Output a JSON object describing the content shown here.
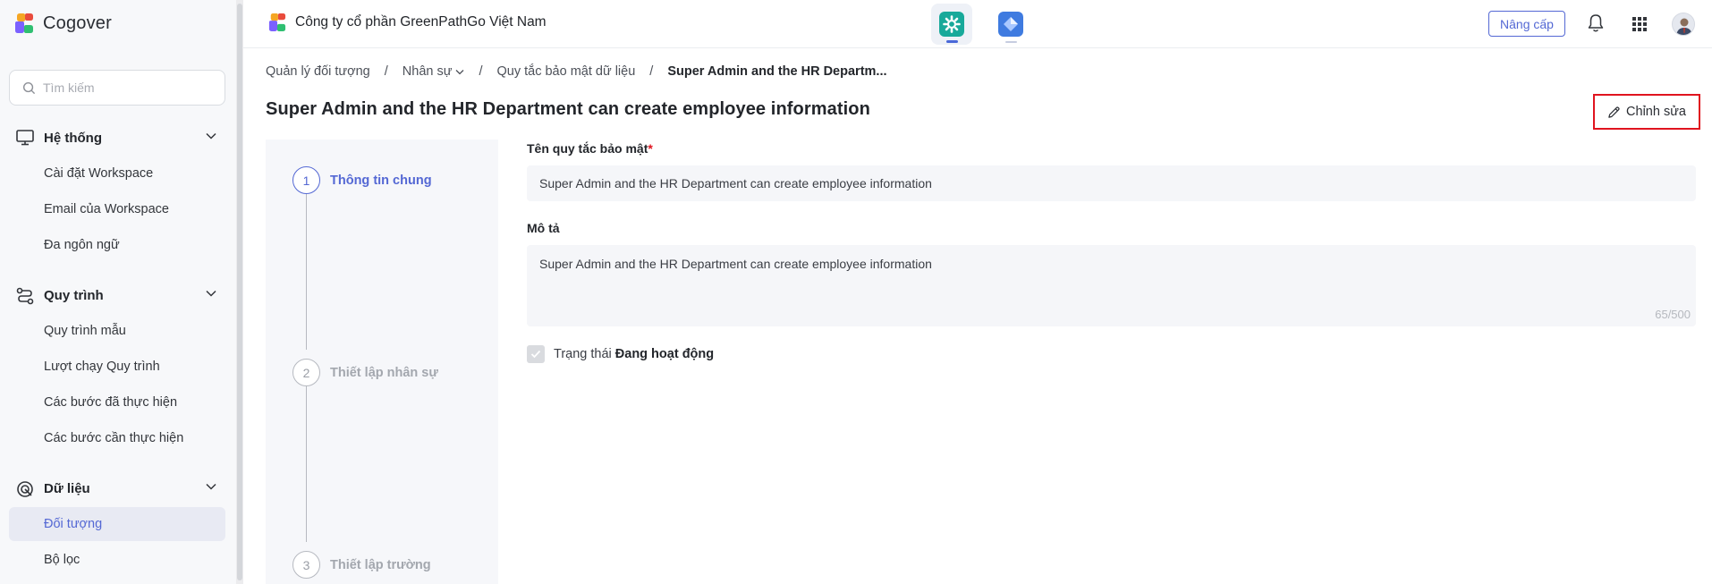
{
  "app": {
    "name": "Cogover",
    "brand_colors": [
      "#f5a623",
      "#e94b3c",
      "#7b61ff",
      "#2fbf71"
    ]
  },
  "sidebar": {
    "search_placeholder": "Tìm kiếm",
    "groups": [
      {
        "label": "Hệ thống",
        "icon": "monitor-icon",
        "items": [
          {
            "label": "Cài đặt Workspace"
          },
          {
            "label": "Email của Workspace"
          },
          {
            "label": "Đa ngôn ngữ"
          }
        ]
      },
      {
        "label": "Quy trình",
        "icon": "workflow-icon",
        "items": [
          {
            "label": "Quy trình mẫu"
          },
          {
            "label": "Lượt chạy Quy trình"
          },
          {
            "label": "Các bước đã thực hiện"
          },
          {
            "label": "Các bước cần thực hiện"
          }
        ]
      },
      {
        "label": "Dữ liệu",
        "icon": "data-icon",
        "items": [
          {
            "label": "Đối tượng",
            "active": true
          },
          {
            "label": "Bộ lọc"
          }
        ]
      }
    ]
  },
  "topbar": {
    "company_name": "Công ty cổ phần GreenPathGo Việt Nam",
    "apps": [
      {
        "icon": "settings-app-icon",
        "active": true,
        "color": "#18a99a"
      },
      {
        "icon": "diamond-app-icon",
        "active": false,
        "color": "#3f7be0"
      }
    ],
    "upgrade_label": "Nâng cấp",
    "icons": [
      "bell-icon",
      "apps-grid-icon",
      "avatar"
    ]
  },
  "breadcrumb": {
    "items": [
      "Quản lý đối tượng",
      "Nhân sự",
      "Quy tắc bảo mật dữ liệu"
    ],
    "current": "Super Admin and the HR Departm..."
  },
  "page": {
    "title": "Super Admin and the HR Department can create employee information",
    "edit_label": "Chỉnh sửa"
  },
  "stepper": {
    "steps": [
      {
        "number": "1",
        "label": "Thông tin chung",
        "active": true
      },
      {
        "number": "2",
        "label": "Thiết lập nhân sự",
        "active": false
      },
      {
        "number": "3",
        "label": "Thiết lập trường",
        "active": false
      }
    ]
  },
  "form": {
    "name_label": "Tên quy tắc bảo mật",
    "required_mark": "*",
    "name_value": "Super Admin and the HR Department can create employee information",
    "desc_label": "Mô tả",
    "desc_value": "Super Admin and the HR Department can create employee information",
    "desc_counter": "65/500",
    "status_prefix": "Trạng thái",
    "status_value": "Đang hoạt động",
    "status_checked": true
  },
  "colors": {
    "accent": "#5468d4",
    "highlight_border": "#e0141f",
    "active_item_bg": "#e8eaf3"
  }
}
